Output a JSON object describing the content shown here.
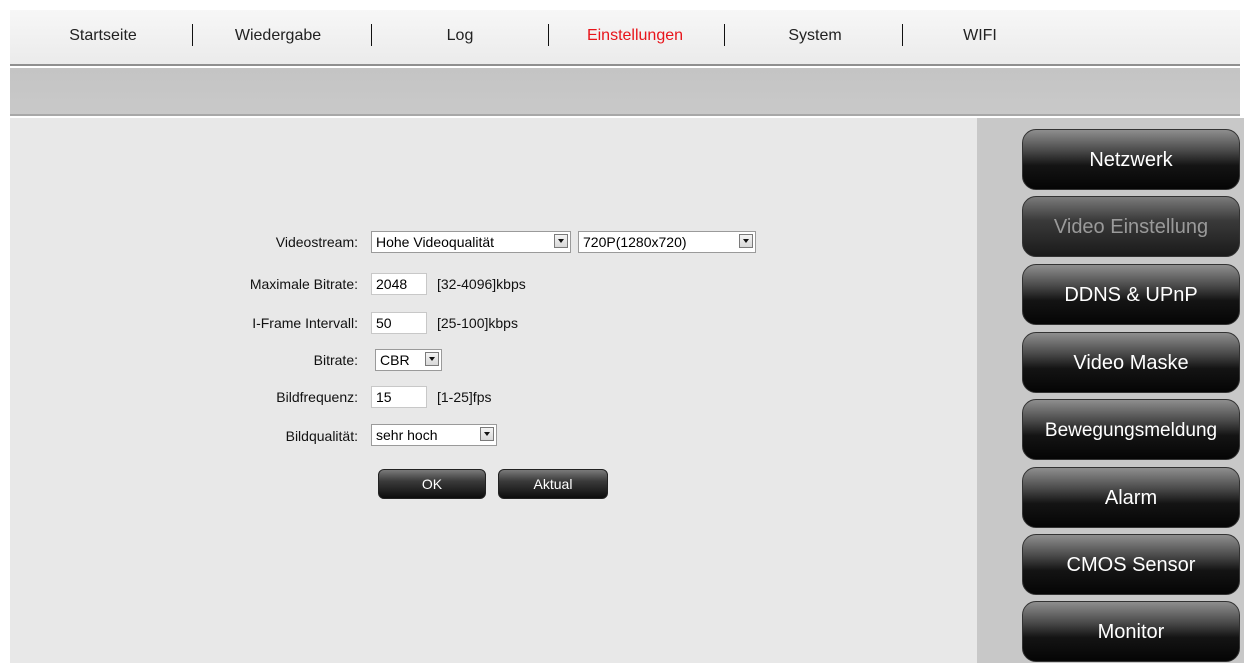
{
  "topnav": {
    "items": [
      {
        "label": "Startseite",
        "active": false
      },
      {
        "label": "Wiedergabe",
        "active": false
      },
      {
        "label": "Log",
        "active": false
      },
      {
        "label": "Einstellungen",
        "active": true
      },
      {
        "label": "System",
        "active": false
      },
      {
        "label": "WIFI",
        "active": false
      }
    ]
  },
  "form": {
    "videostream": {
      "label": "Videostream:",
      "quality_value": "Hohe Videoqualität",
      "resolution_value": "720P(1280x720)"
    },
    "max_bitrate": {
      "label": "Maximale Bitrate:",
      "value": "2048",
      "hint": "[32-4096]kbps"
    },
    "iframe_interval": {
      "label": "I-Frame Intervall:",
      "value": "50",
      "hint": "[25-100]kbps"
    },
    "bitrate": {
      "label": "Bitrate:",
      "value": "CBR"
    },
    "framerate": {
      "label": "Bildfrequenz:",
      "value": "15",
      "hint": "[1-25]fps"
    },
    "image_quality": {
      "label": "Bildqualität:",
      "value": "sehr hoch"
    },
    "ok_label": "OK",
    "refresh_label": "Aktual"
  },
  "sidebar": {
    "items": [
      {
        "label": "Netzwerk",
        "selected": false
      },
      {
        "label": "Video Einstellung",
        "selected": true
      },
      {
        "label": "DDNS & UPnP",
        "selected": false
      },
      {
        "label": "Video Maske",
        "selected": false
      },
      {
        "label": "Bewegungsmeldung",
        "selected": false
      },
      {
        "label": "Alarm",
        "selected": false
      },
      {
        "label": "CMOS Sensor",
        "selected": false
      },
      {
        "label": "Monitor",
        "selected": false
      }
    ]
  },
  "colors": {
    "active_nav": "#e8141a",
    "selected_sidebar_text": "#9a9a9a"
  }
}
